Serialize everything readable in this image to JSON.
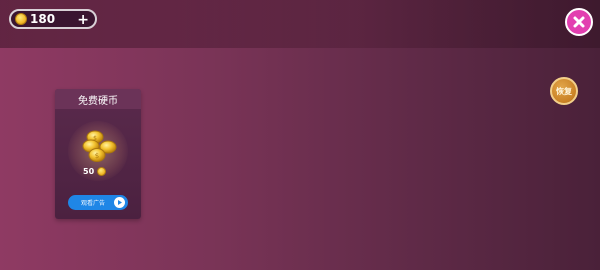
{
  "hud": {
    "coins": "180",
    "add_symbol": "+"
  },
  "buttons": {
    "restore_label": "恢复"
  },
  "offer_card": {
    "title": "免费硬币",
    "reward_amount": "50",
    "watch_label": "观看广告"
  },
  "colors": {
    "background_left": "#8f3a63",
    "background_right": "#4a2139",
    "close_button": "#e23fb0",
    "watch_button": "#1f86e6",
    "coin_gold": "#f2b92a"
  },
  "icons": {
    "coin": "gold-coin",
    "add": "plus",
    "close": "x-mark",
    "play": "play-triangle"
  }
}
